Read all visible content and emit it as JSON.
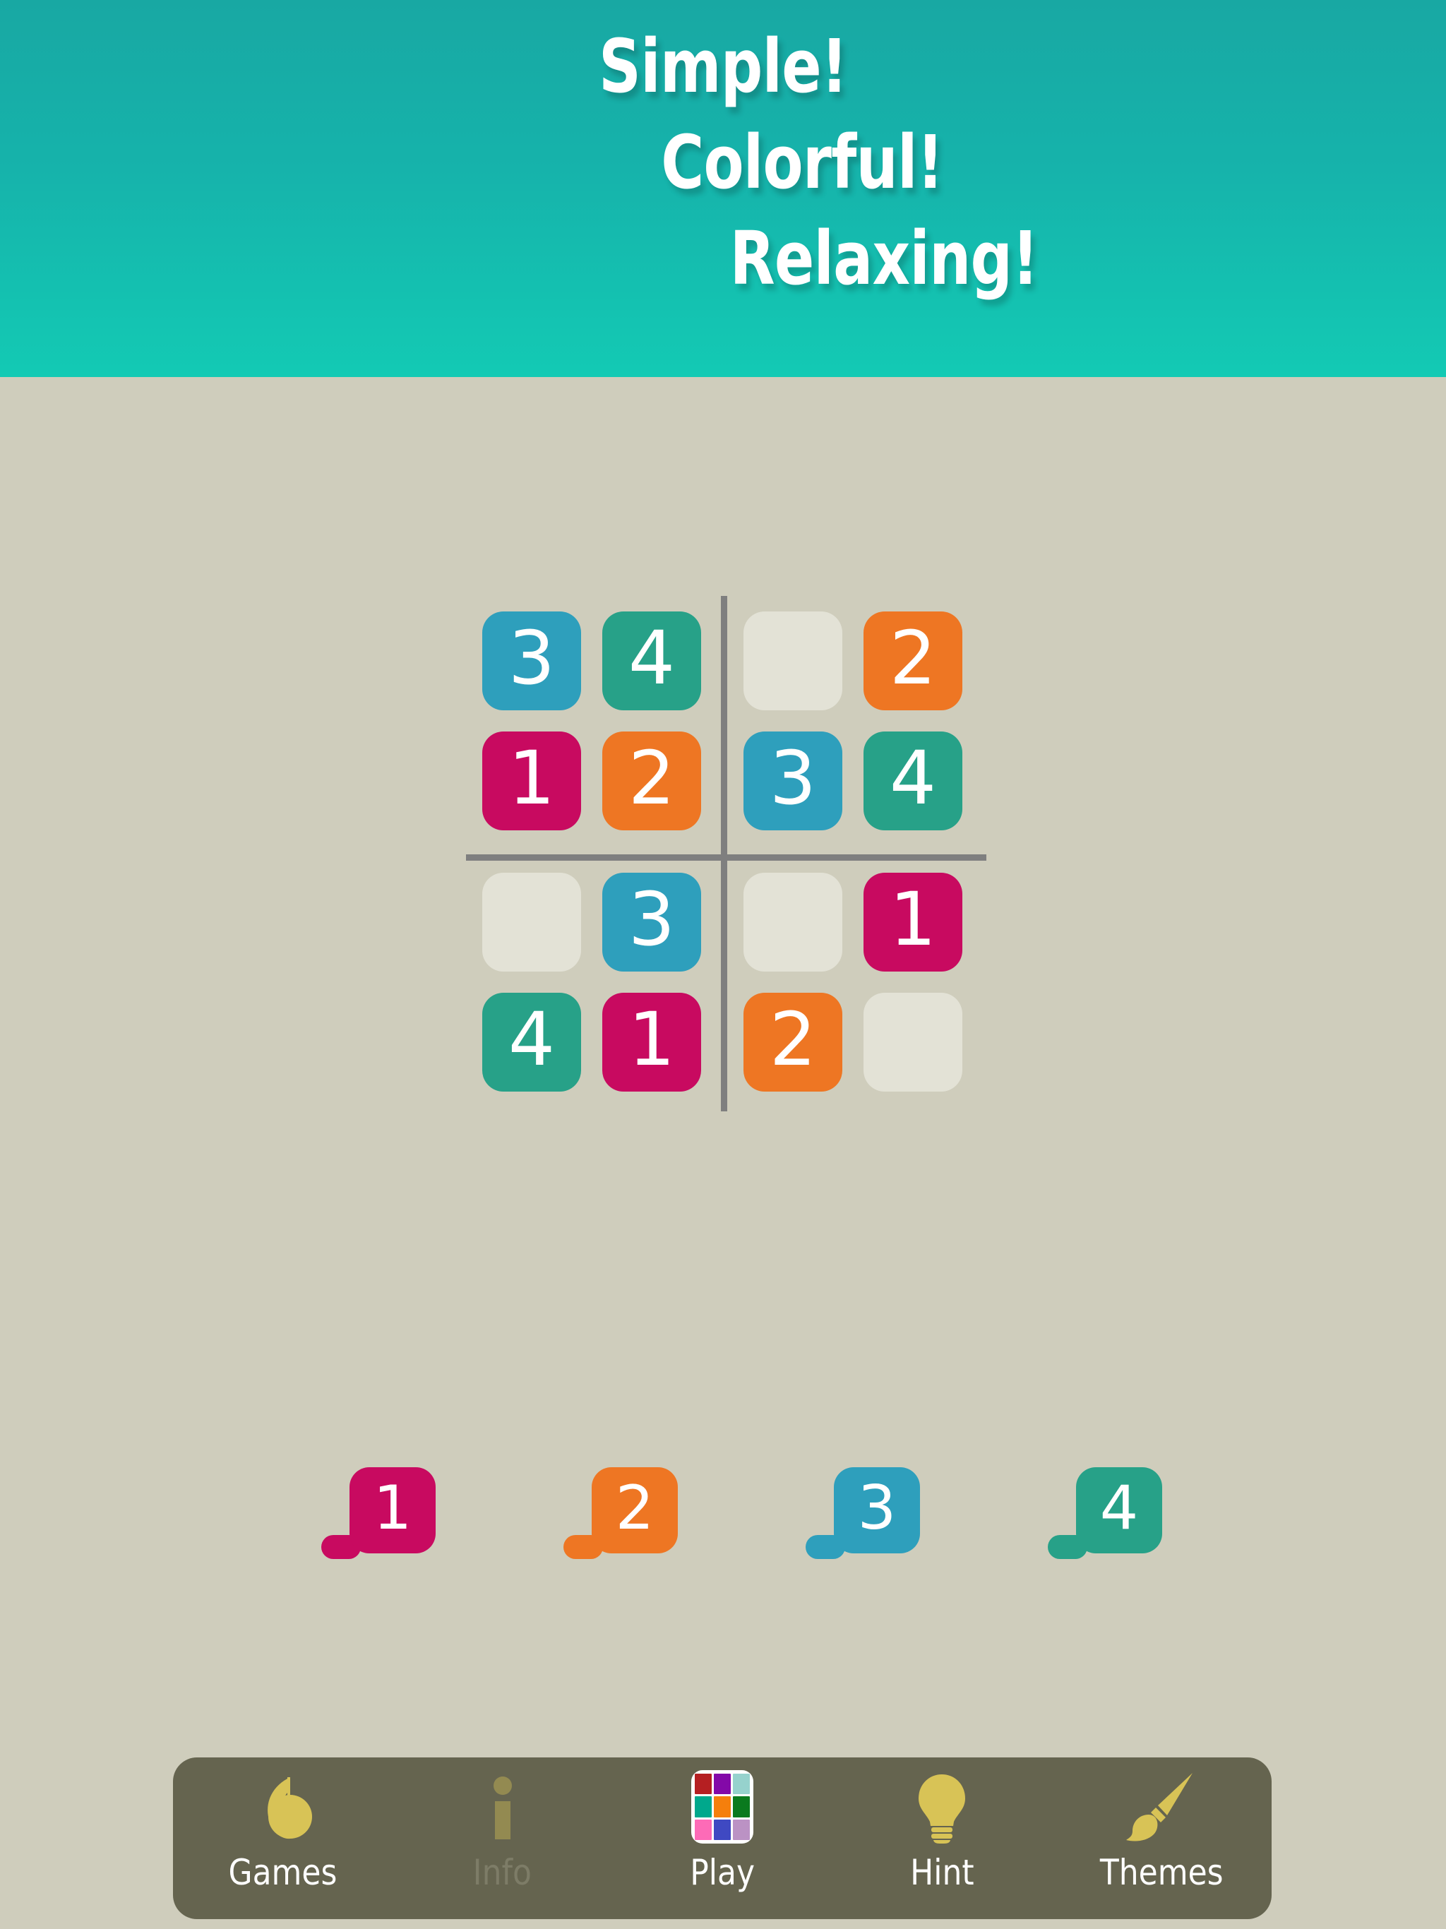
{
  "header": {
    "lines": [
      "Simple!",
      "Colorful!",
      "Relaxing!"
    ],
    "bg_top": "#18a8a3",
    "bg_bottom": "#13cab4",
    "text_color": "#ffffff"
  },
  "theme": {
    "page_background": "#cfcdbc",
    "empty_cell": "#e3e2d6",
    "divider": "#7f7f7f",
    "toolbar_background": "#65644f",
    "toolbar_icon": "#d8c356",
    "toolbar_label": "#ffffff",
    "toolbar_label_disabled": "#7d7c67"
  },
  "value_colors": {
    "1": "#c80a60",
    "2": "#ee7623",
    "3": "#2e9fbc",
    "4": "#27a188"
  },
  "board": {
    "size": 4,
    "box_rows": 2,
    "box_cols": 2,
    "cells": [
      [
        {
          "value": "3",
          "filled": true
        },
        {
          "value": "4",
          "filled": true
        },
        {
          "value": "",
          "filled": false
        },
        {
          "value": "2",
          "filled": true
        }
      ],
      [
        {
          "value": "1",
          "filled": true
        },
        {
          "value": "2",
          "filled": true
        },
        {
          "value": "3",
          "filled": true
        },
        {
          "value": "4",
          "filled": true
        }
      ],
      [
        {
          "value": "",
          "filled": false
        },
        {
          "value": "3",
          "filled": true
        },
        {
          "value": "",
          "filled": false
        },
        {
          "value": "1",
          "filled": true
        }
      ],
      [
        {
          "value": "4",
          "filled": true
        },
        {
          "value": "1",
          "filled": true
        },
        {
          "value": "2",
          "filled": true
        },
        {
          "value": "",
          "filled": false
        }
      ]
    ]
  },
  "numpad": {
    "buttons": [
      {
        "label": "1",
        "color": "#c80a60"
      },
      {
        "label": "2",
        "color": "#ee7623"
      },
      {
        "label": "3",
        "color": "#2e9fbc"
      },
      {
        "label": "4",
        "color": "#27a188"
      }
    ]
  },
  "toolbar": {
    "items": [
      {
        "label": "Games",
        "icon": "note-logo-icon",
        "enabled": true
      },
      {
        "label": "Info",
        "icon": "info-icon",
        "enabled": false
      },
      {
        "label": "Play",
        "icon": "color-grid-icon",
        "enabled": true
      },
      {
        "label": "Hint",
        "icon": "lightbulb-icon",
        "enabled": true
      },
      {
        "label": "Themes",
        "icon": "paintbrush-icon",
        "enabled": true
      }
    ]
  },
  "play_icon_colors": [
    "#b51f22",
    "#8309a8",
    "#96d2cd",
    "#00a88c",
    "#f57f0c",
    "#0a7a1e",
    "#fd6bb7",
    "#3f49c2",
    "#bb92c4"
  ]
}
